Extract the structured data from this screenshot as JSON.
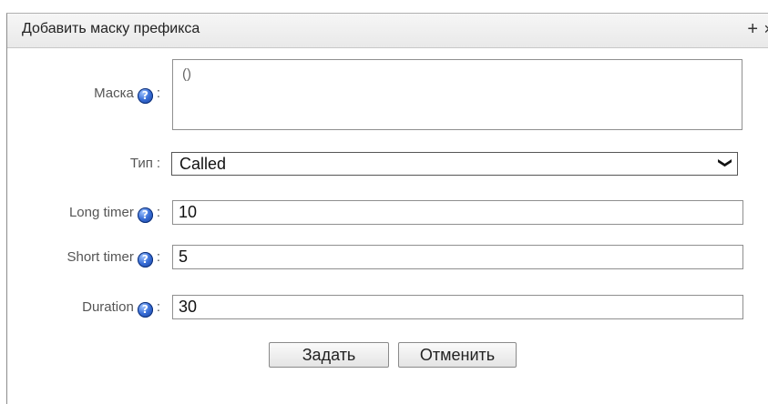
{
  "dialog": {
    "title": "Добавить маску префикса",
    "plus_icon": "+",
    "close_icon": "×"
  },
  "form": {
    "mask": {
      "label": "Маска",
      "value": "()"
    },
    "type": {
      "label": "Тип",
      "value": "Called"
    },
    "long_timer": {
      "label": "Long timer",
      "value": "10"
    },
    "short_timer": {
      "label": "Short timer",
      "value": "5"
    },
    "duration": {
      "label": "Duration",
      "value": "30"
    },
    "colon": ":",
    "help_glyph": "?"
  },
  "buttons": {
    "submit": "Задать",
    "cancel": "Отменить"
  }
}
